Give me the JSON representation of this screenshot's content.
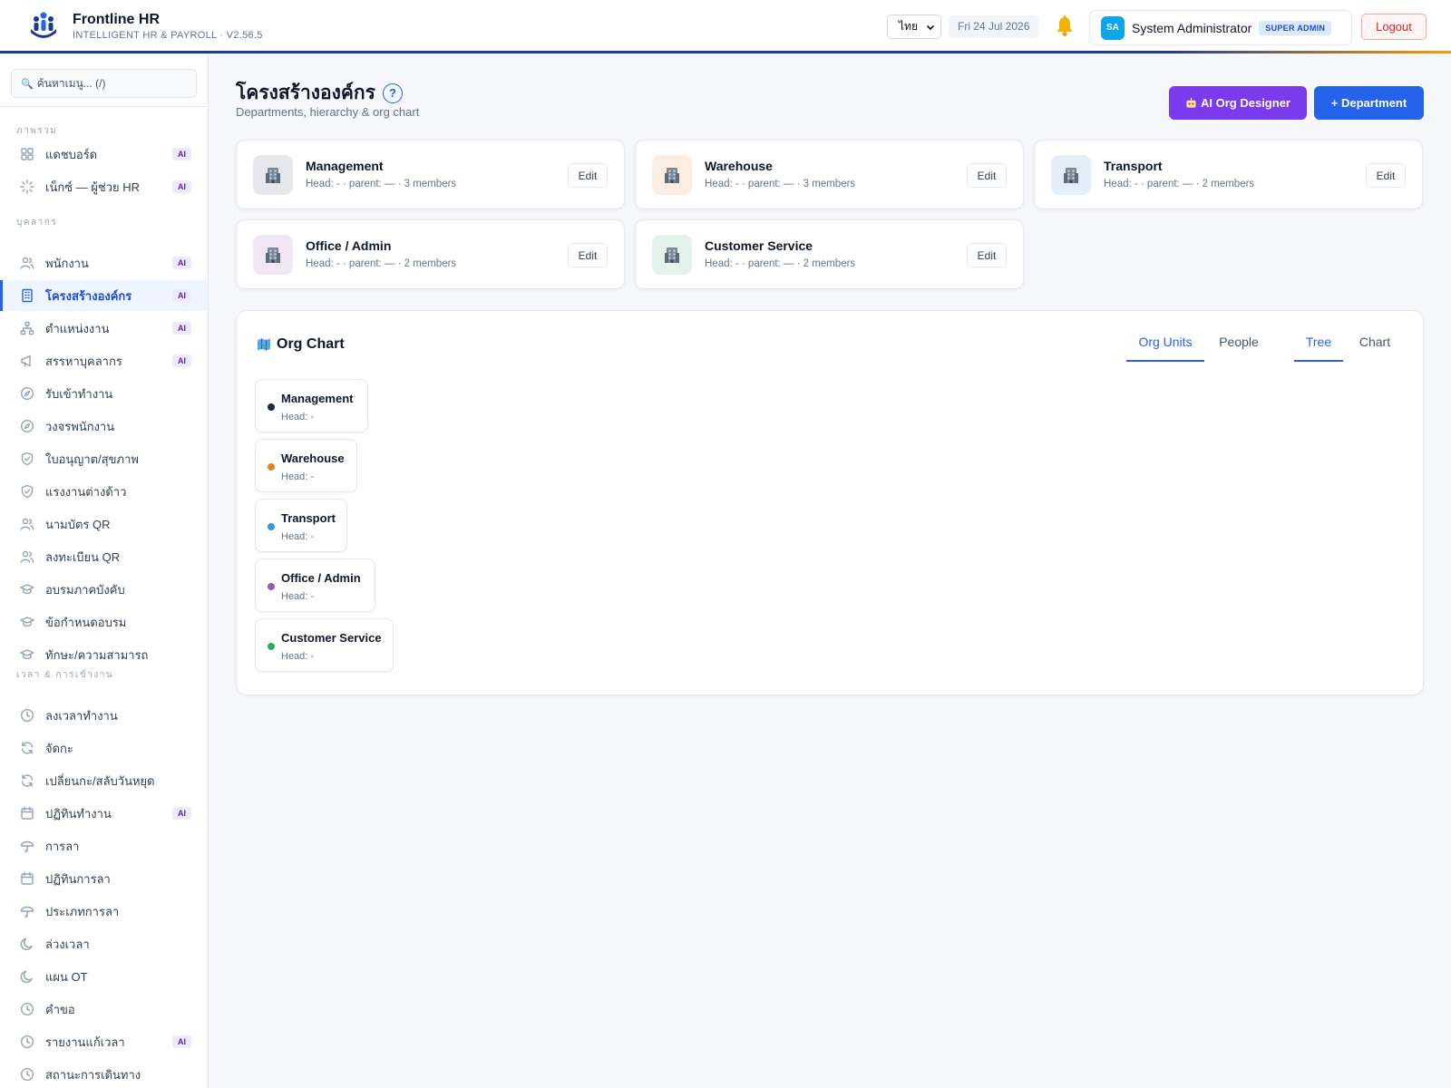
{
  "app": {
    "name": "Frontline HR",
    "subtitle": "INTELLIGENT HR & PAYROLL · V2.56.5"
  },
  "header": {
    "language": "ไทย",
    "date": "Fri 24 Jul 2026",
    "user_initials": "SA",
    "user_name": "System Administrator",
    "role": "SUPER ADMIN",
    "logout_label": "Logout"
  },
  "sidebar": {
    "search_placeholder": "ค้นหาเมนู... (/)",
    "sections": {
      "overview": "ภาพรวม",
      "people": "บุคลากร",
      "time": "เวลา & การเข้างาน"
    },
    "ai_label": "AI",
    "items": [
      {
        "label": "แดชบอร์ด",
        "icon": "grid-icon",
        "ai": true
      },
      {
        "label": "เน็กซ์ — ผู้ช่วย HR",
        "icon": "sparkle-icon",
        "ai": true
      },
      {
        "label": "พนักงาน",
        "icon": "users-icon",
        "ai": true
      },
      {
        "label": "โครงสร้างองค์กร",
        "icon": "building-icon",
        "ai": true,
        "active": true
      },
      {
        "label": "ตำแหน่งงาน",
        "icon": "hierarchy-icon",
        "ai": true
      },
      {
        "label": "สรรหาบุคลากร",
        "icon": "megaphone-icon",
        "ai": true
      },
      {
        "label": "รับเข้าทำงาน",
        "icon": "compass-icon",
        "ai": false
      },
      {
        "label": "วงจรพนักงาน",
        "icon": "compass-icon",
        "ai": false
      },
      {
        "label": "ใบอนุญาต/สุขภาพ",
        "icon": "shield-icon",
        "ai": false
      },
      {
        "label": "แรงงานต่างด้าว",
        "icon": "shield-icon",
        "ai": false
      },
      {
        "label": "นามบัตร QR",
        "icon": "users-icon",
        "ai": false
      },
      {
        "label": "ลงทะเบียน QR",
        "icon": "users-icon",
        "ai": false
      },
      {
        "label": "อบรมภาคบังคับ",
        "icon": "graduation-cap-icon",
        "ai": false
      },
      {
        "label": "ข้อกำหนดอบรม",
        "icon": "graduation-cap-icon",
        "ai": false
      },
      {
        "label": "ทักษะ/ความสามารถ",
        "icon": "graduation-cap-icon",
        "ai": false
      },
      {
        "label": "ลงเวลาทำงาน",
        "icon": "clock-icon",
        "ai": false
      },
      {
        "label": "จัดกะ",
        "icon": "refresh-icon",
        "ai": false
      },
      {
        "label": "เปลี่ยนกะ/สลับวันหยุด",
        "icon": "refresh-icon",
        "ai": false
      },
      {
        "label": "ปฏิทินทำงาน",
        "icon": "calendar-icon",
        "ai": true
      },
      {
        "label": "การลา",
        "icon": "umbrella-icon",
        "ai": false
      },
      {
        "label": "ปฏิทินการลา",
        "icon": "calendar-icon",
        "ai": false
      },
      {
        "label": "ประเภทการลา",
        "icon": "umbrella-icon",
        "ai": false
      },
      {
        "label": "ล่วงเวลา",
        "icon": "moon-icon",
        "ai": false
      },
      {
        "label": "แผน OT",
        "icon": "moon-icon",
        "ai": false
      },
      {
        "label": "คำขอ",
        "icon": "clock-icon",
        "ai": false
      },
      {
        "label": "รายงานแก้เวลา",
        "icon": "clock-icon",
        "ai": true
      },
      {
        "label": "สถานะการเดินทาง",
        "icon": "clock-icon",
        "ai": false
      }
    ]
  },
  "page": {
    "title": "โครงสร้างองค์กร",
    "help": "?",
    "subtitle": "Departments, hierarchy & org chart",
    "ai_designer_label": "AI Org Designer",
    "add_department_label": "+ Department"
  },
  "departments": [
    {
      "name": "Management",
      "meta": "Head: - · parent: — · 3 members",
      "icon_bg": "#e5e7eb",
      "edit": "Edit"
    },
    {
      "name": "Warehouse",
      "meta": "Head: - · parent: — · 3 members",
      "icon_bg": "#fdece0",
      "edit": "Edit"
    },
    {
      "name": "Transport",
      "meta": "Head: - · parent: — · 2 members",
      "icon_bg": "#e3eef9",
      "edit": "Edit"
    },
    {
      "name": "Office / Admin",
      "meta": "Head: - · parent: — · 2 members",
      "icon_bg": "#f1e6f5",
      "edit": "Edit"
    },
    {
      "name": "Customer Service",
      "meta": "Head: - · parent: — · 2 members",
      "icon_bg": "#e3f2ea",
      "edit": "Edit"
    }
  ],
  "org_chart": {
    "title": "Org Chart",
    "tabs_view": [
      "Org Units",
      "People"
    ],
    "tabs_mode": [
      "Tree",
      "Chart"
    ],
    "active_view": "Org Units",
    "active_mode": "Tree",
    "nodes": [
      {
        "name": "Management",
        "head": "Head: -",
        "color": "#1e293b"
      },
      {
        "name": "Warehouse",
        "head": "Head: -",
        "color": "#e67e22"
      },
      {
        "name": "Transport",
        "head": "Head: -",
        "color": "#3498db"
      },
      {
        "name": "Office / Admin",
        "head": "Head: -",
        "color": "#9b59b6"
      },
      {
        "name": "Customer Service",
        "head": "Head: -",
        "color": "#27ae60"
      }
    ]
  }
}
